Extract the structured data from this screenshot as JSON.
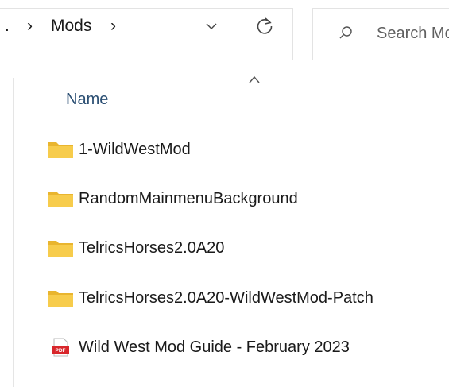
{
  "address_bar": {
    "breadcrumb_overflow": ".",
    "separator": "›",
    "current_folder": "Mods"
  },
  "search": {
    "placeholder": "Search Mods"
  },
  "file_list": {
    "column_name": "Name",
    "items": [
      {
        "name": "1-WildWestMod",
        "type": "folder"
      },
      {
        "name": "RandomMainmenuBackground",
        "type": "folder"
      },
      {
        "name": "TelricsHorses2.0A20",
        "type": "folder"
      },
      {
        "name": "TelricsHorses2.0A20-WildWestMod-Patch",
        "type": "folder"
      },
      {
        "name": "Wild West Mod Guide - February 2023",
        "type": "pdf"
      }
    ]
  },
  "icons": {
    "folder": "folder-icon",
    "pdf": "pdf-file-icon",
    "dropdown": "chevron-down-icon",
    "refresh": "refresh-icon",
    "search": "search-icon",
    "sort": "sort-ascending-icon"
  },
  "colors": {
    "folder_yellow": "#f4c84a",
    "pdf_red": "#d8262b",
    "header_text": "#2b4f73"
  }
}
